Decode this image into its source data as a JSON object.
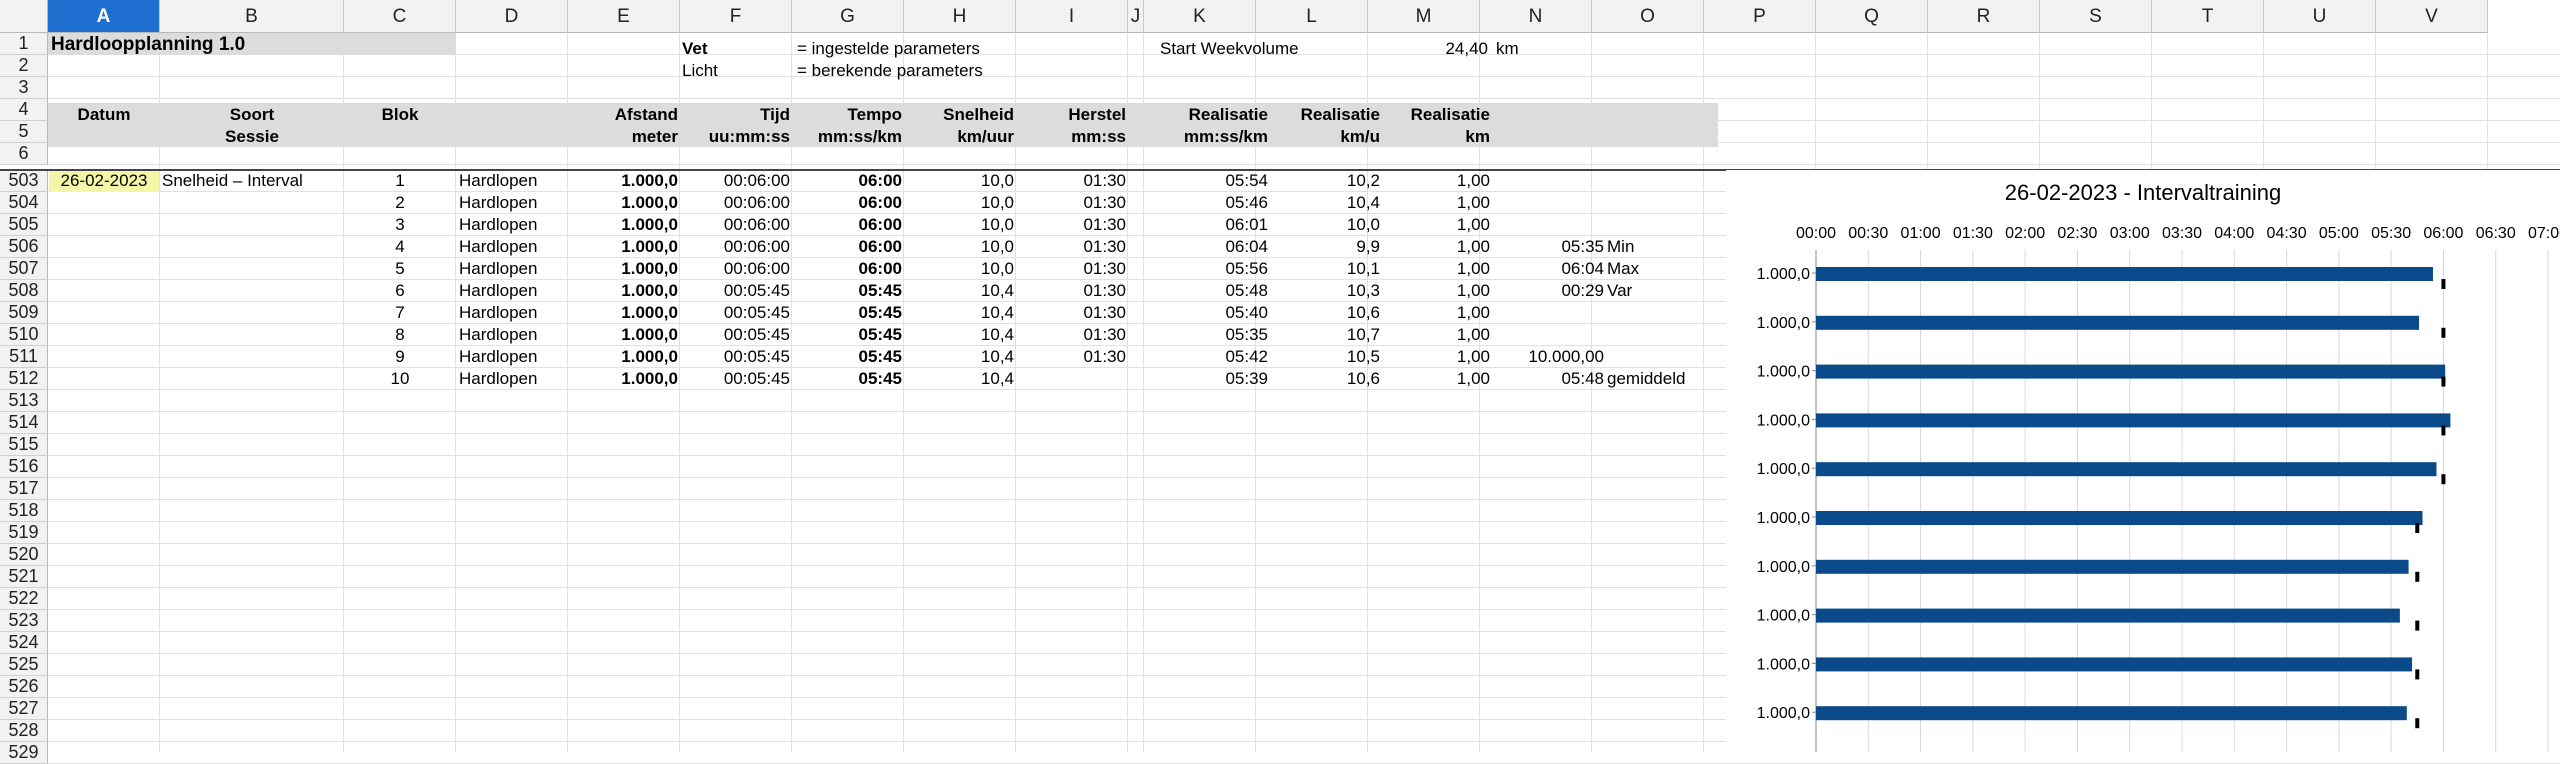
{
  "columns": [
    "A",
    "B",
    "C",
    "D",
    "E",
    "F",
    "G",
    "H",
    "I",
    "J",
    "K",
    "L",
    "M",
    "N",
    "O",
    "P",
    "Q",
    "R",
    "S",
    "T",
    "U",
    "V"
  ],
  "selected_column": "A",
  "rows_top": [
    "1",
    "2",
    "3",
    "4",
    "5",
    "6"
  ],
  "rows_body": [
    "503",
    "504",
    "505",
    "506",
    "507",
    "508",
    "509",
    "510",
    "511",
    "512",
    "513",
    "514",
    "515",
    "516",
    "517",
    "518",
    "519",
    "520",
    "521",
    "522",
    "523",
    "524",
    "525",
    "526",
    "527",
    "528",
    "529"
  ],
  "header": {
    "title": "Hardloopplanning 1.0",
    "vet": "Vet",
    "vet_desc": "= ingestelde parameters",
    "licht": "Licht",
    "licht_desc": "= berekende parameters",
    "start_weekvolume_label": "Start Weekvolume",
    "start_weekvolume_value": "24,40",
    "start_weekvolume_unit": "km"
  },
  "table_headers": {
    "datum": "Datum",
    "soort": "Soort",
    "sessie": "Sessie",
    "blok": "Blok",
    "afstand": "Afstand",
    "meter": "meter",
    "tijd": "Tijd",
    "tijd_unit": "uu:mm:ss",
    "tempo": "Tempo",
    "tempo_unit": "mm:ss/km",
    "snelheid": "Snelheid",
    "snelheid_unit": "km/uur",
    "herstel": "Herstel",
    "herstel_unit": "mm:ss",
    "realisatie1": "Realisatie",
    "realisatie1_unit": "mm:ss/km",
    "realisatie2": "Realisatie",
    "realisatie2_unit": "km/u",
    "realisatie3": "Realisatie",
    "realisatie3_unit": "km"
  },
  "session": {
    "date": "26-02-2023",
    "type": "Snelheid – Interval"
  },
  "data_rows": [
    {
      "blok": "1",
      "act": "Hardlopen",
      "afstand": "1.000,0",
      "tijd": "00:06:00",
      "tempo": "06:00",
      "snelheid": "10,0",
      "herstel": "01:30",
      "real_tempo": "05:54",
      "real_kmu": "10,2",
      "real_km": "1,00"
    },
    {
      "blok": "2",
      "act": "Hardlopen",
      "afstand": "1.000,0",
      "tijd": "00:06:00",
      "tempo": "06:00",
      "snelheid": "10,0",
      "herstel": "01:30",
      "real_tempo": "05:46",
      "real_kmu": "10,4",
      "real_km": "1,00"
    },
    {
      "blok": "3",
      "act": "Hardlopen",
      "afstand": "1.000,0",
      "tijd": "00:06:00",
      "tempo": "06:00",
      "snelheid": "10,0",
      "herstel": "01:30",
      "real_tempo": "06:01",
      "real_kmu": "10,0",
      "real_km": "1,00"
    },
    {
      "blok": "4",
      "act": "Hardlopen",
      "afstand": "1.000,0",
      "tijd": "00:06:00",
      "tempo": "06:00",
      "snelheid": "10,0",
      "herstel": "01:30",
      "real_tempo": "06:04",
      "real_kmu": "9,9",
      "real_km": "1,00"
    },
    {
      "blok": "5",
      "act": "Hardlopen",
      "afstand": "1.000,0",
      "tijd": "00:06:00",
      "tempo": "06:00",
      "snelheid": "10,0",
      "herstel": "01:30",
      "real_tempo": "05:56",
      "real_kmu": "10,1",
      "real_km": "1,00"
    },
    {
      "blok": "6",
      "act": "Hardlopen",
      "afstand": "1.000,0",
      "tijd": "00:05:45",
      "tempo": "05:45",
      "snelheid": "10,4",
      "herstel": "01:30",
      "real_tempo": "05:48",
      "real_kmu": "10,3",
      "real_km": "1,00"
    },
    {
      "blok": "7",
      "act": "Hardlopen",
      "afstand": "1.000,0",
      "tijd": "00:05:45",
      "tempo": "05:45",
      "snelheid": "10,4",
      "herstel": "01:30",
      "real_tempo": "05:40",
      "real_kmu": "10,6",
      "real_km": "1,00"
    },
    {
      "blok": "8",
      "act": "Hardlopen",
      "afstand": "1.000,0",
      "tijd": "00:05:45",
      "tempo": "05:45",
      "snelheid": "10,4",
      "herstel": "01:30",
      "real_tempo": "05:35",
      "real_kmu": "10,7",
      "real_km": "1,00"
    },
    {
      "blok": "9",
      "act": "Hardlopen",
      "afstand": "1.000,0",
      "tijd": "00:05:45",
      "tempo": "05:45",
      "snelheid": "10,4",
      "herstel": "01:30",
      "real_tempo": "05:42",
      "real_kmu": "10,5",
      "real_km": "1,00"
    },
    {
      "blok": "10",
      "act": "Hardlopen",
      "afstand": "1.000,0",
      "tijd": "00:05:45",
      "tempo": "05:45",
      "snelheid": "10,4",
      "herstel": "",
      "real_tempo": "05:39",
      "real_kmu": "10,6",
      "real_km": "1,00"
    }
  ],
  "stats": {
    "min_value": "05:35",
    "min_label": "Min",
    "max_value": "06:04",
    "max_label": "Max",
    "var_value": "00:29",
    "var_label": "Var",
    "total": "10.000,00",
    "avg_value": "05:48",
    "avg_label": "gemiddeld"
  },
  "colors": {
    "bar": "#0a4a8a",
    "marker": "#000000",
    "header_band": "#dcdcdc",
    "date_highlight": "#f4f7a7",
    "selected_col": "#1e6fd0"
  },
  "chart_data": {
    "type": "bar",
    "orientation": "horizontal",
    "title": "26-02-2023 - Intervaltraining",
    "categories": [
      "1.000,0",
      "1.000,0",
      "1.000,0",
      "1.000,0",
      "1.000,0",
      "1.000,0",
      "1.000,0",
      "1.000,0",
      "1.000,0",
      "1.000,0"
    ],
    "x_ticks": [
      "00:00",
      "00:30",
      "01:00",
      "01:30",
      "02:00",
      "02:30",
      "03:00",
      "03:30",
      "04:00",
      "04:30",
      "05:00",
      "05:30",
      "06:00",
      "06:30",
      "07:00"
    ],
    "xlim_seconds": [
      0,
      420
    ],
    "axis_position": "top",
    "series": [
      {
        "values_seconds": [
          354,
          346,
          361,
          364,
          356,
          348,
          340,
          335,
          342,
          339
        ],
        "color": "#0a4a8a"
      },
      {
        "values_seconds": [
          360,
          360,
          360,
          360,
          360,
          345,
          345,
          345,
          345,
          345
        ],
        "color": "#000000",
        "marker": "dash"
      }
    ],
    "grid": true
  }
}
